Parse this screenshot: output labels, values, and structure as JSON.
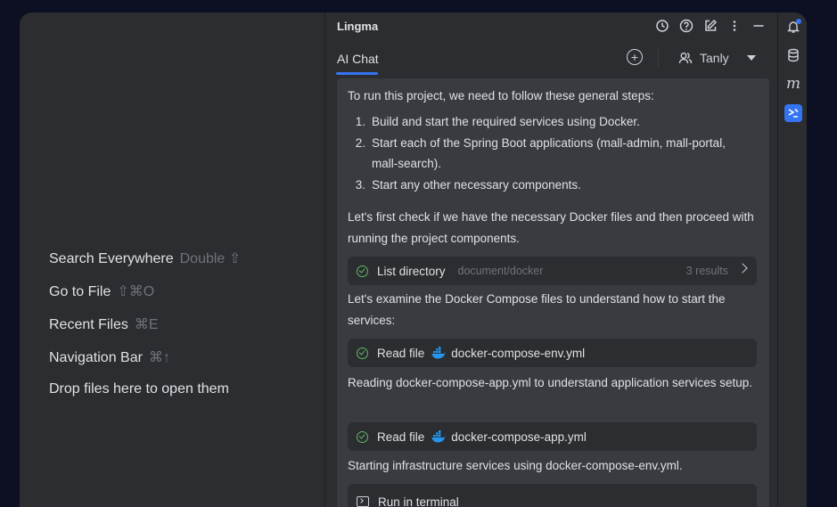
{
  "empty_editor": {
    "hints": [
      {
        "label": "Search Everywhere",
        "shortcut": "Double ⇧"
      },
      {
        "label": "Go to File",
        "shortcut": "⇧⌘O"
      },
      {
        "label": "Recent Files",
        "shortcut": "⌘E"
      },
      {
        "label": "Navigation Bar",
        "shortcut": "⌘↑"
      },
      {
        "label": "Drop files here to open them",
        "shortcut": ""
      }
    ]
  },
  "panel": {
    "title": "Lingma",
    "icons": [
      "history-icon",
      "help-icon",
      "edit-icon",
      "more-icon",
      "minimize-icon"
    ],
    "tab_label": "AI Chat",
    "user_name": "Tanly"
  },
  "chat": {
    "intro": "To run this project, we need to follow these general steps:",
    "steps": [
      {
        "num": "1.",
        "text": "Build and start the required services using Docker."
      },
      {
        "num": "2.",
        "text": "Start each of the Spring Boot applications (mall-admin, mall-portal, mall-search)."
      },
      {
        "num": "3.",
        "text": "Start any other necessary components."
      }
    ],
    "check_text": "Let's first check if we have the necessary Docker files and then proceed with running the project components.",
    "list_tool": {
      "label": "List directory",
      "path": "document/docker",
      "count": "3 results"
    },
    "examine_text": "Let's examine the Docker Compose files to understand how to start the services:",
    "read_tool_1": {
      "label": "Read file",
      "file": "docker-compose-env.yml"
    },
    "reading_text": "Reading docker-compose-app.yml to understand application services setup.",
    "read_tool_2": {
      "label": "Read file",
      "file": "docker-compose-app.yml"
    },
    "starting_text": "Starting infrastructure services using docker-compose-env.yml.",
    "terminal_tool": {
      "label": "Run in terminal"
    }
  },
  "colors": {
    "accent": "#3574f0",
    "success": "#5fb865",
    "docker": "#2496ed"
  }
}
